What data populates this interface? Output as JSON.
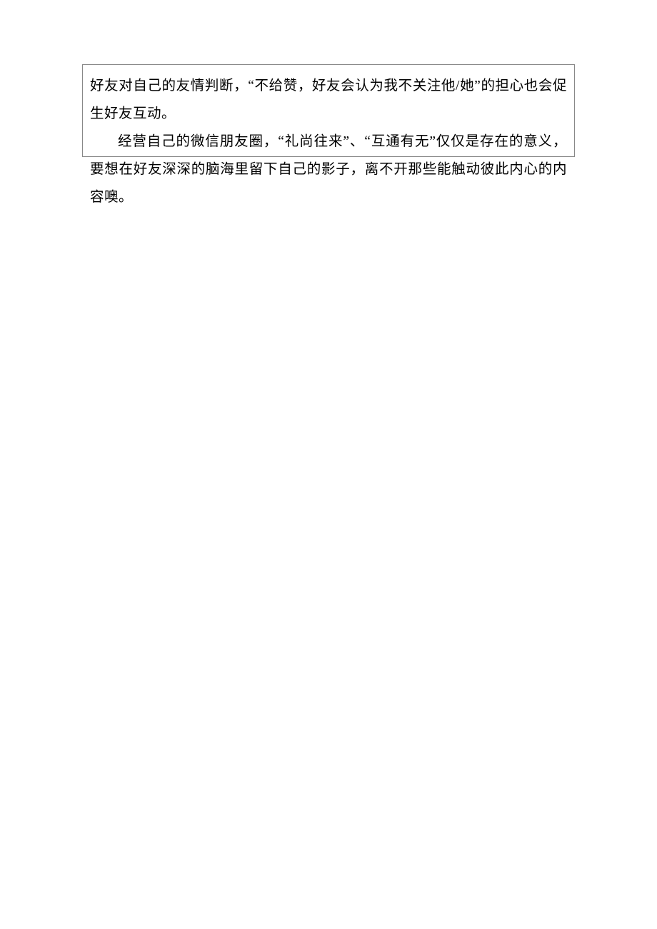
{
  "document": {
    "paragraphs": [
      "好友对自己的友情判断，“不给赞，好友会认为我不关注他/她”的担心也会促生好友互动。",
      "经营自己的微信朋友圈，“礼尚往来”、“互通有无”仅仅是存在的意义，要想在好友深深的脑海里留下自己的影子，离不开那些能触动彼此内心的内容噢。"
    ]
  }
}
